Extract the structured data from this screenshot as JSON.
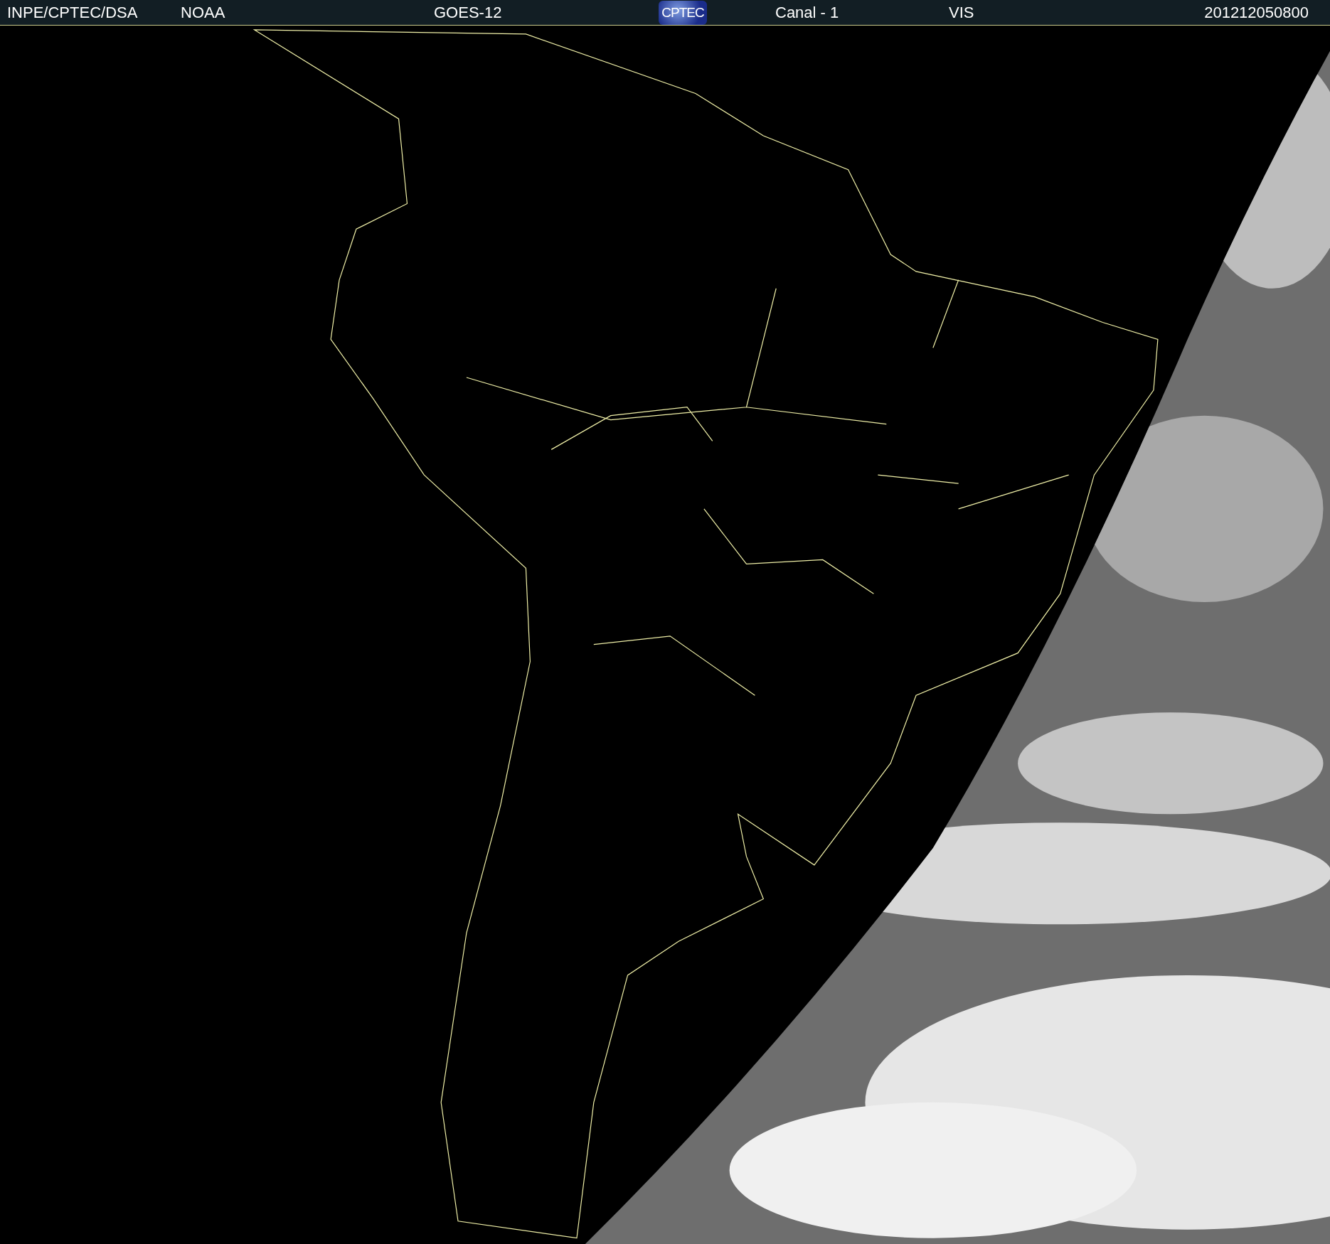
{
  "header": {
    "source": "INPE/CPTEC/DSA",
    "agency": "NOAA",
    "satellite": "GOES-12",
    "logo": "CPTEC",
    "channel": "Canal - 1",
    "band": "VIS",
    "timestamp": "201212050800"
  }
}
